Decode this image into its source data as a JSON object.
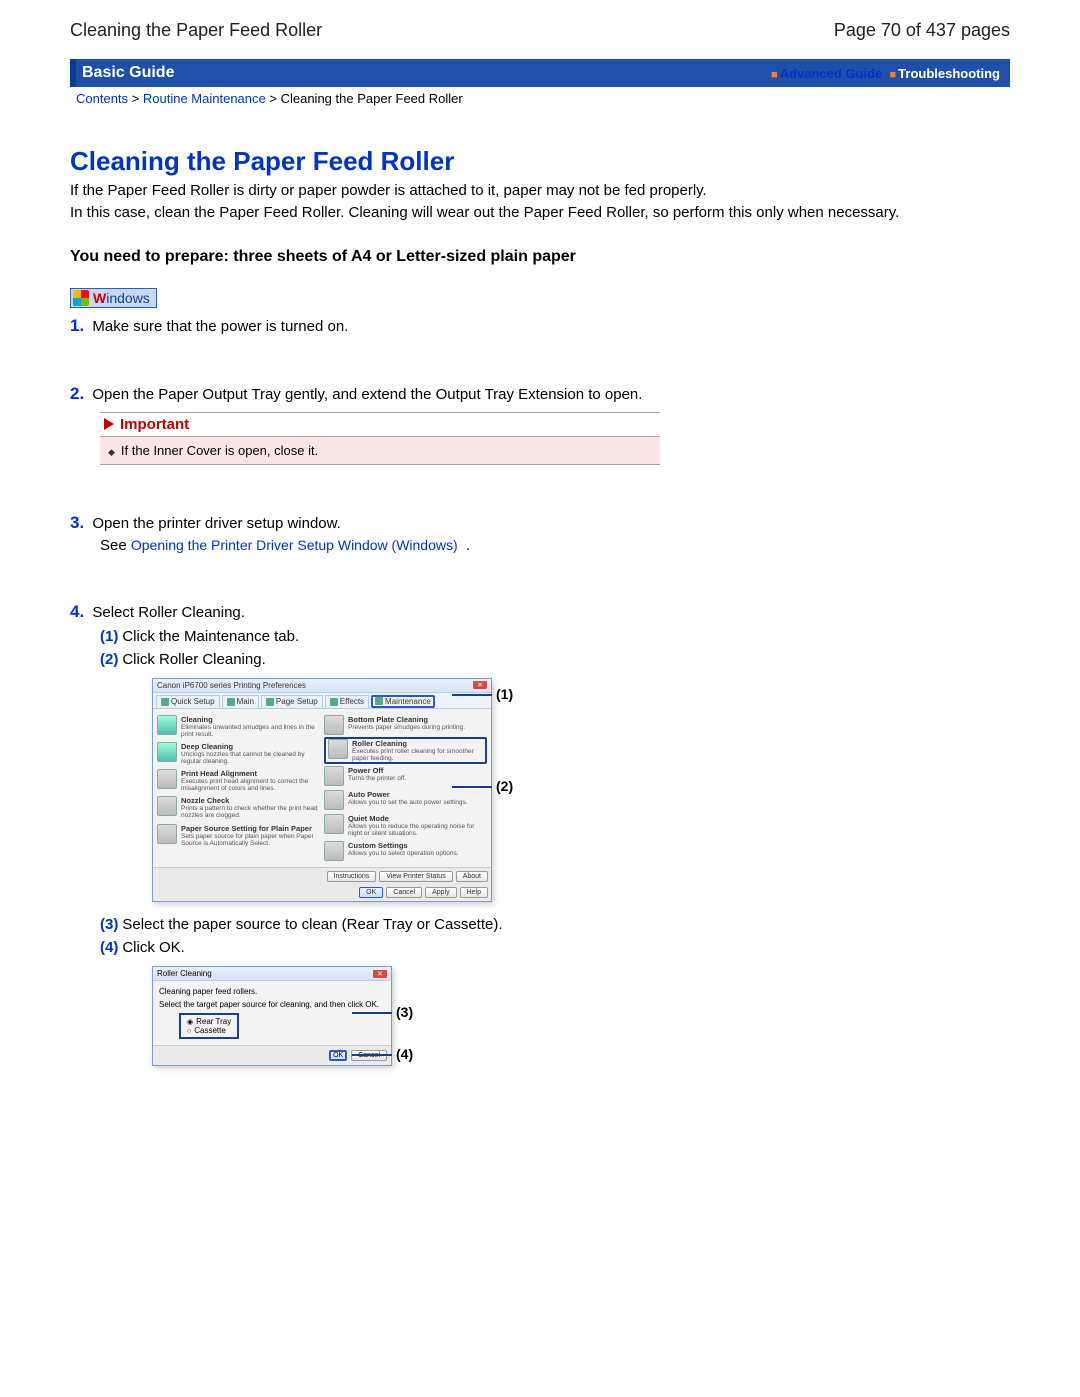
{
  "header": {
    "left": "Cleaning the Paper Feed Roller",
    "right": "Page 70 of 437 pages"
  },
  "blueBar": {
    "left": "Basic Guide",
    "advanced": "Advanced Guide",
    "troubleshooting": "Troubleshooting"
  },
  "breadcrumb": {
    "contents": "Contents",
    "routine": "Routine Maintenance",
    "current": "Cleaning the Paper Feed Roller"
  },
  "title": "Cleaning the Paper Feed Roller",
  "intro": {
    "p1": "If the Paper Feed Roller is dirty or paper powder is attached to it, paper may not be fed properly.",
    "p2": "In this case, clean the Paper Feed Roller. Cleaning will wear out the Paper Feed Roller, so perform this only when necessary."
  },
  "prepare": "You need to prepare: three sheets of A4 or Letter-sized plain paper",
  "windows_label": "indows",
  "steps": {
    "s1": "Make sure that the power is turned on.",
    "s2": "Open the Paper Output Tray gently, and extend the Output Tray Extension to open.",
    "important_label": "Important",
    "important_body": "If the Inner Cover is open, close it.",
    "s3": "Open the printer driver setup window.",
    "s3_see": "See ",
    "s3_link": "Opening the Printer Driver Setup Window (Windows)",
    "s4": "Select Roller Cleaning.",
    "s4_1": "Click the Maintenance tab.",
    "s4_2": "Click Roller Cleaning.",
    "s4_3": "Select the paper source to clean (Rear Tray or Cassette).",
    "s4_4": "Click OK."
  },
  "dlg1": {
    "title": "Canon iP6700 series Printing Preferences",
    "tabs": [
      "Quick Setup",
      "Main",
      "Page Setup",
      "Effects",
      "Maintenance"
    ],
    "left": [
      {
        "t": "Cleaning",
        "d": "Eliminates unwanted smudges and lines in the print result."
      },
      {
        "t": "Deep Cleaning",
        "d": "Unclogs nozzles that cannot be cleaned by regular cleaning."
      },
      {
        "t": "Print Head Alignment",
        "d": "Executes print head alignment to correct the misalignment of colors and lines."
      },
      {
        "t": "Nozzle Check",
        "d": "Prints a pattern to check whether the print head nozzles are clogged."
      },
      {
        "t": "Paper Source Setting for Plain Paper",
        "d": "Sets paper source for plain paper when Paper Source is Automatically Select."
      }
    ],
    "right": [
      {
        "t": "Bottom Plate Cleaning",
        "d": "Prevents paper smudges during printing."
      },
      {
        "t": "Roller Cleaning",
        "d": "Executes print roller cleaning for smoother paper feeding."
      },
      {
        "t": "Power Off",
        "d": "Turns the printer off."
      },
      {
        "t": "Auto Power",
        "d": "Allows you to set the auto power settings."
      },
      {
        "t": "Quiet Mode",
        "d": "Allows you to reduce the operating noise for night or silent situations."
      },
      {
        "t": "Custom Settings",
        "d": "Allows you to select operation options."
      }
    ],
    "btns_row1": [
      "Instructions",
      "View Printer Status",
      "About"
    ],
    "btns_row2": [
      "OK",
      "Cancel",
      "Apply",
      "Help"
    ],
    "callout1": "(1)",
    "callout2": "(2)"
  },
  "dlg2": {
    "title": "Roller Cleaning",
    "heading": "Cleaning paper feed rollers.",
    "prompt": "Select the target paper source for cleaning, and then click OK.",
    "opt1": "Rear Tray",
    "opt2": "Cassette",
    "ok": "OK",
    "cancel": "Cancel",
    "callout3": "(3)",
    "callout4": "(4)"
  }
}
